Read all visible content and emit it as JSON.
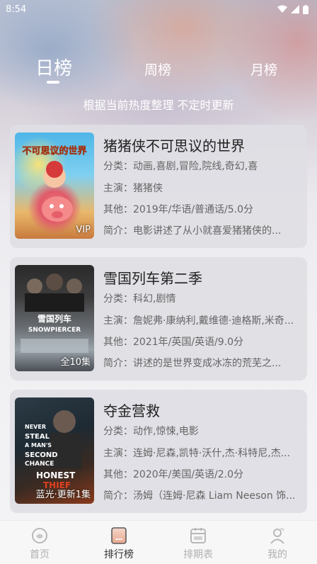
{
  "status": {
    "time": "8:54"
  },
  "tabs": [
    {
      "label": "日榜",
      "active": true
    },
    {
      "label": "周榜",
      "active": false
    },
    {
      "label": "月榜",
      "active": false
    }
  ],
  "subtitle": "根据当前热度整理 不定时更新",
  "movies": [
    {
      "title": "猪猪侠不可思议的世界",
      "badge": "VIP",
      "poster_text": "不可思议的世界",
      "category": "分类：动画,喜剧,冒险,院线,奇幻,喜",
      "cast": "主演：猪猪侠",
      "other": "其他：2019年/华语/普通话/5.0分",
      "summary": "简介：电影讲述了从小就喜爱猪猪侠的..."
    },
    {
      "title": "雪国列车第二季",
      "badge": "全10集",
      "poster_text": "雪国列车 SNOWPIERCER",
      "category": "分类：科幻,剧情",
      "cast": "主演：詹妮弗·康纳利,戴维德·迪格斯,米奇...",
      "other": "其他：2021年/英国/英语/9.0分",
      "summary": "简介：讲述的是世界变成冰冻的荒芜之..."
    },
    {
      "title": "夺金营救",
      "badge": "蓝光·更新1集",
      "poster_text": "NEVER STEAL A MAN'S SECOND CHANCE HONEST THIEF",
      "category": "分类：动作,惊悚,电影",
      "cast": "主演：连姆·尼森,凯特·沃什,杰·科特尼,杰...",
      "other": "其他：2020年/美国/英语/2.0分",
      "summary": "简介：汤姆（连姆·尼森 Liam Neeson 饰..."
    }
  ],
  "nav": [
    {
      "label": "首页",
      "icon": "home-icon",
      "active": false
    },
    {
      "label": "排行榜",
      "icon": "ranking-icon",
      "active": true
    },
    {
      "label": "排期表",
      "icon": "schedule-icon",
      "active": false
    },
    {
      "label": "我的",
      "icon": "profile-icon",
      "active": false
    }
  ],
  "colors": {
    "card_bg": "#dedee4",
    "accent": "#ffffff",
    "nav_active": "#333333",
    "nav_inactive": "#b0b0b0"
  }
}
